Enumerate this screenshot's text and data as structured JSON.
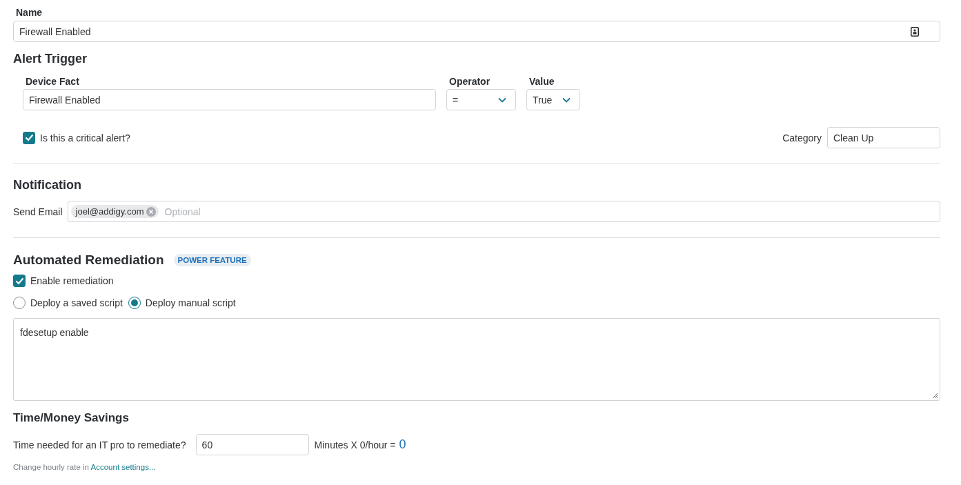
{
  "name_field": {
    "label": "Name",
    "value": "Firewall Enabled"
  },
  "alert_trigger": {
    "title": "Alert Trigger",
    "device_fact": {
      "label": "Device Fact",
      "value": "Firewall Enabled"
    },
    "operator": {
      "label": "Operator",
      "value": "="
    },
    "value": {
      "label": "Value",
      "value": "True"
    },
    "critical": {
      "label": "Is this a critical alert?",
      "checked": true
    },
    "category": {
      "label": "Category",
      "value": "Clean Up"
    }
  },
  "notification": {
    "title": "Notification",
    "send_email": {
      "label": "Send Email",
      "tags": [
        "joel@addigy.com"
      ],
      "placeholder": "Optional"
    }
  },
  "remediation": {
    "title": "Automated Remediation",
    "badge": "POWER FEATURE",
    "enable": {
      "label": "Enable remediation",
      "checked": true
    },
    "options": [
      {
        "label": "Deploy a saved script",
        "selected": false
      },
      {
        "label": "Deploy manual script",
        "selected": true
      }
    ],
    "script": "fdesetup enable"
  },
  "savings": {
    "title": "Time/Money Savings",
    "question": "Time needed for an IT pro to remediate?",
    "minutes": "60",
    "formula": "Minutes X 0/hour =",
    "result": "0",
    "note": "Change hourly rate in",
    "link": "Account settings..."
  }
}
